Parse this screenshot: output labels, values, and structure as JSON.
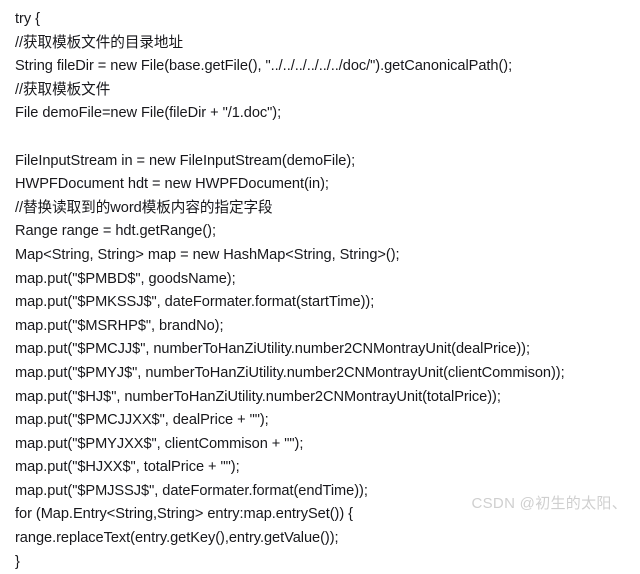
{
  "snippet": {
    "language": "java",
    "background_color": "#ffffff",
    "text_color": "#17171b",
    "lines": [
      "try {",
      "//获取模板文件的目录地址",
      "String fileDir = new File(base.getFile(), \"../../../../../../doc/\").getCanonicalPath();",
      "//获取模板文件",
      "File demoFile=new File(fileDir + \"/1.doc\");",
      "",
      "FileInputStream in = new FileInputStream(demoFile);",
      "HWPFDocument hdt = new HWPFDocument(in);",
      "//替换读取到的word模板内容的指定字段",
      "Range range = hdt.getRange();",
      "Map<String, String> map = new HashMap<String, String>();",
      "map.put(\"$PMBD$\", goodsName);",
      "map.put(\"$PMKSSJ$\", dateFormater.format(startTime));",
      "map.put(\"$MSRHP$\", brandNo);",
      "map.put(\"$PMCJJ$\", numberToHanZiUtility.number2CNMontrayUnit(dealPrice));",
      "map.put(\"$PMYJ$\", numberToHanZiUtility.number2CNMontrayUnit(clientCommison));",
      "map.put(\"$HJ$\", numberToHanZiUtility.number2CNMontrayUnit(totalPrice));",
      "map.put(\"$PMCJJXX$\", dealPrice + \"\");",
      "map.put(\"$PMYJXX$\", clientCommison + \"\");",
      "map.put(\"$HJXX$\", totalPrice + \"\");",
      "map.put(\"$PMJSSJ$\", dateFormater.format(endTime));",
      "for (Map.Entry<String,String> entry:map.entrySet()) {",
      "range.replaceText(entry.getKey(),entry.getValue());",
      "}"
    ]
  },
  "watermark": {
    "text": "CSDN @初生的太阳、",
    "color": "#cfcfcf"
  }
}
